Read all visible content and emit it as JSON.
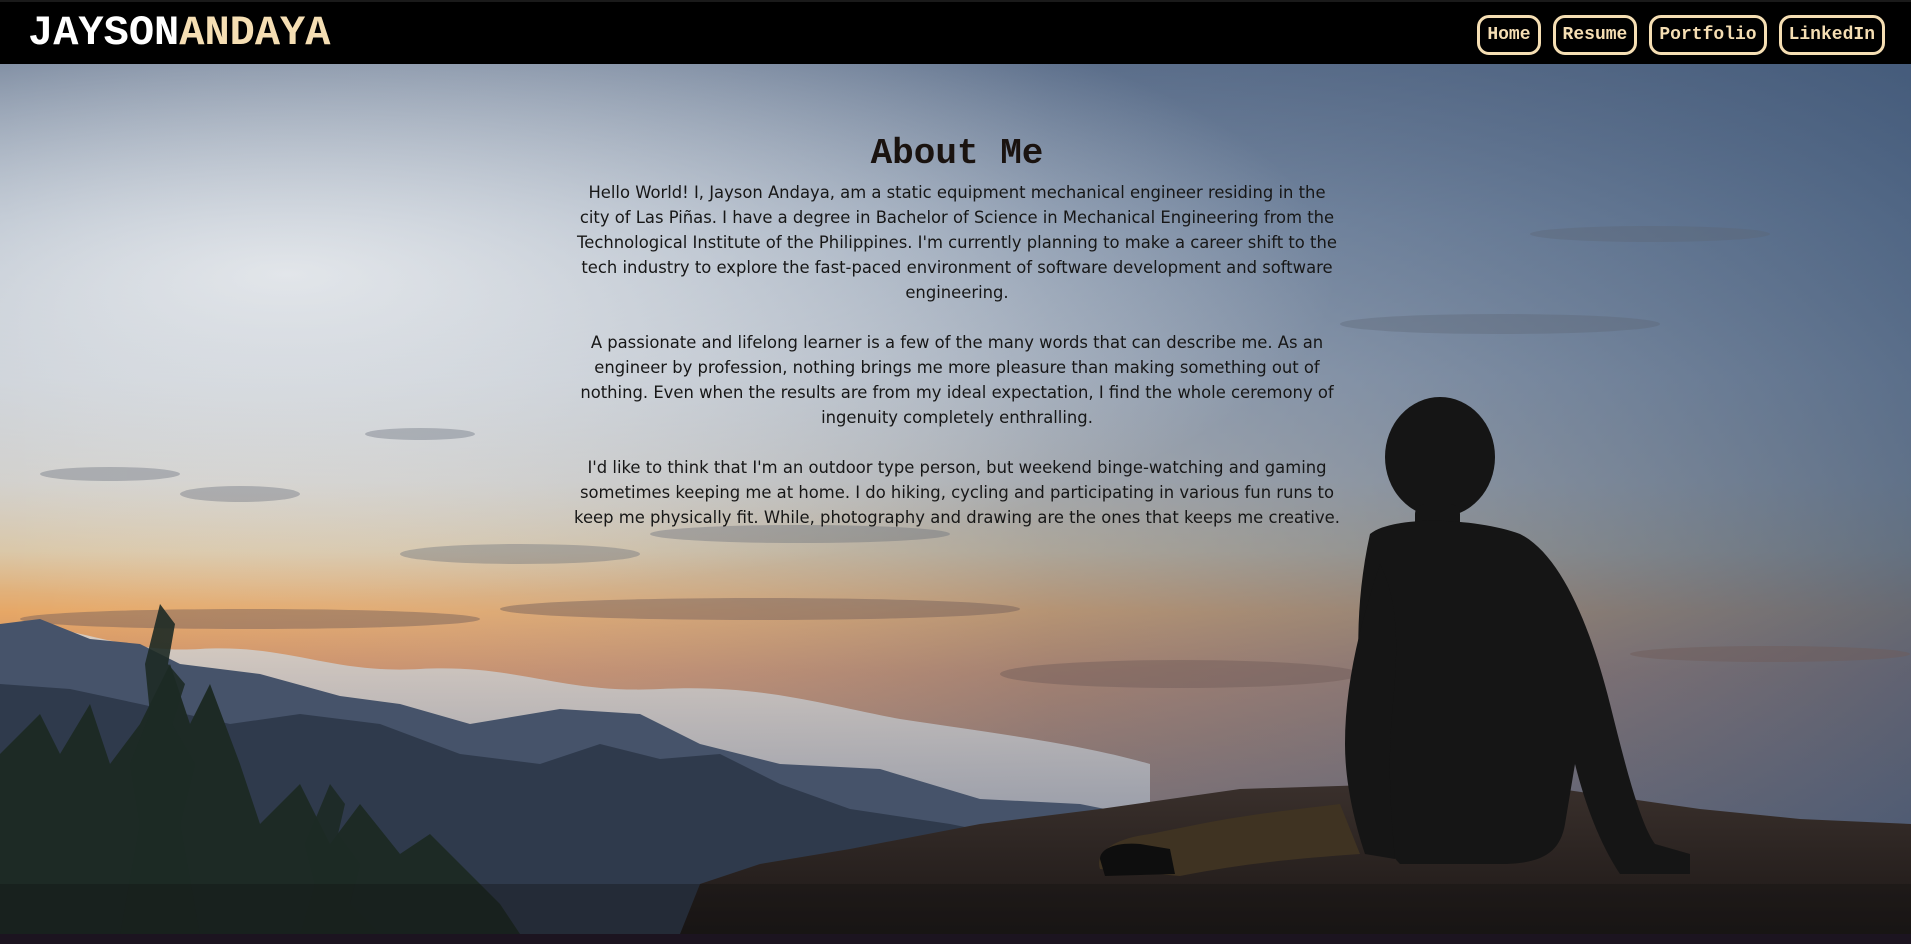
{
  "brand": {
    "first": "JAYSON",
    "last": "ANDAYA"
  },
  "nav": {
    "items": [
      {
        "label": "Home"
      },
      {
        "label": "Resume"
      },
      {
        "label": "Portfolio"
      },
      {
        "label": "LinkedIn"
      }
    ]
  },
  "about": {
    "title": "About Me",
    "paragraphs": [
      "Hello World! I, Jayson Andaya, am a static equipment mechanical engineer residing in the city of Las Piñas. I have a degree in Bachelor of Science in Mechanical Engineering from the Technological Institute of the Philippines. I'm currently planning to make a career shift to the tech industry to explore the fast-paced environment of software development and software engineering.",
      "A passionate and lifelong learner is a few of the many words that can describe me. As an engineer by profession, nothing brings me more pleasure than making something out of nothing. Even when the results are from my ideal expectation, I find the whole ceremony of ingenuity completely enthralling.",
      "I'd like to think that I'm an outdoor type person, but weekend binge-watching and gaming sometimes keeping me at home. I do hiking, cycling and participating in various fun runs to keep me physically fit. While, photography and drawing are the ones that keeps me creative."
    ]
  },
  "colors": {
    "header_bg": "#000000",
    "accent": "#f5deb3",
    "brand_first": "#ffffff"
  }
}
